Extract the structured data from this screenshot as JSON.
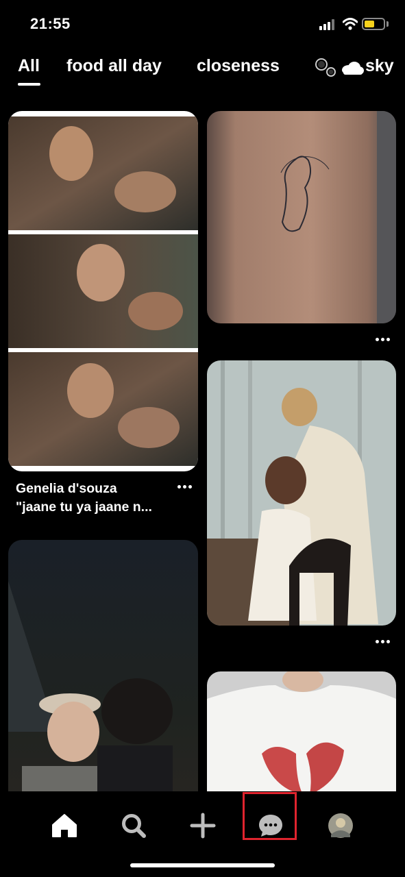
{
  "status_bar": {
    "time": "21:55",
    "battery_color": "#f7d21c"
  },
  "tabs": [
    {
      "label": "All",
      "selected": true
    },
    {
      "label": "food all day",
      "selected": false
    },
    {
      "label": "closeness",
      "selected": false
    },
    {
      "label": "sky",
      "selected": false,
      "icons": [
        "bubbles-icon",
        "cloud-icon"
      ]
    }
  ],
  "pins": [
    {
      "id": "pin-1",
      "title_line1": "Genelia d'souza",
      "title_line2": "\"jaane tu ya jaane n...",
      "image": "three-panel-photo-collage"
    },
    {
      "id": "pin-2",
      "image": "back-tattoo-photo"
    },
    {
      "id": "pin-3",
      "image": "period-drama-still"
    },
    {
      "id": "pin-4",
      "image": "couple-night-photo"
    },
    {
      "id": "pin-5",
      "image": "white-tshirt-photo"
    }
  ],
  "nav": {
    "items": [
      "home-icon",
      "search-icon",
      "create-plus-icon",
      "messages-icon",
      "profile-avatar"
    ],
    "active": "home-icon",
    "highlighted": "messages-icon",
    "highlight_color": "#e0242e"
  }
}
